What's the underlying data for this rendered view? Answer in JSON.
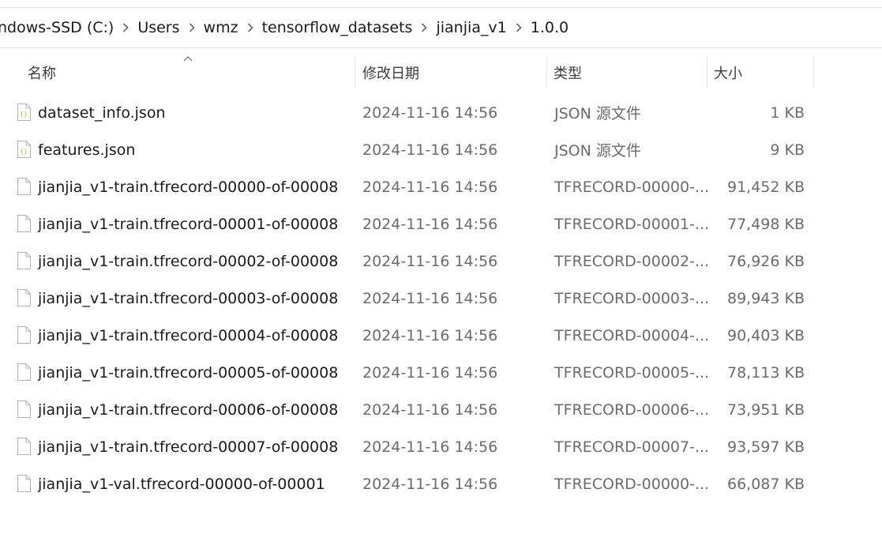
{
  "breadcrumb": {
    "items": [
      "ndows-SSD (C:)",
      "Users",
      "wmz",
      "tensorflow_datasets",
      "jianjia_v1",
      "1.0.0"
    ]
  },
  "columns": {
    "name": "名称",
    "date": "修改日期",
    "type": "类型",
    "size": "大小"
  },
  "files": [
    {
      "name": "dataset_info.json",
      "date": "2024-11-16 14:56",
      "type": "JSON 源文件",
      "size": "1 KB",
      "icon": "json-file-icon"
    },
    {
      "name": "features.json",
      "date": "2024-11-16 14:56",
      "type": "JSON 源文件",
      "size": "9 KB",
      "icon": "json-file-icon"
    },
    {
      "name": "jianjia_v1-train.tfrecord-00000-of-00008",
      "date": "2024-11-16 14:56",
      "type": "TFRECORD-00000-...",
      "size": "91,452 KB",
      "icon": "blank-file-icon"
    },
    {
      "name": "jianjia_v1-train.tfrecord-00001-of-00008",
      "date": "2024-11-16 14:56",
      "type": "TFRECORD-00001-...",
      "size": "77,498 KB",
      "icon": "blank-file-icon"
    },
    {
      "name": "jianjia_v1-train.tfrecord-00002-of-00008",
      "date": "2024-11-16 14:56",
      "type": "TFRECORD-00002-...",
      "size": "76,926 KB",
      "icon": "blank-file-icon"
    },
    {
      "name": "jianjia_v1-train.tfrecord-00003-of-00008",
      "date": "2024-11-16 14:56",
      "type": "TFRECORD-00003-...",
      "size": "89,943 KB",
      "icon": "blank-file-icon"
    },
    {
      "name": "jianjia_v1-train.tfrecord-00004-of-00008",
      "date": "2024-11-16 14:56",
      "type": "TFRECORD-00004-...",
      "size": "90,403 KB",
      "icon": "blank-file-icon"
    },
    {
      "name": "jianjia_v1-train.tfrecord-00005-of-00008",
      "date": "2024-11-16 14:56",
      "type": "TFRECORD-00005-...",
      "size": "78,113 KB",
      "icon": "blank-file-icon"
    },
    {
      "name": "jianjia_v1-train.tfrecord-00006-of-00008",
      "date": "2024-11-16 14:56",
      "type": "TFRECORD-00006-...",
      "size": "73,951 KB",
      "icon": "blank-file-icon"
    },
    {
      "name": "jianjia_v1-train.tfrecord-00007-of-00008",
      "date": "2024-11-16 14:56",
      "type": "TFRECORD-00007-...",
      "size": "93,597 KB",
      "icon": "blank-file-icon"
    },
    {
      "name": "jianjia_v1-val.tfrecord-00000-of-00001",
      "date": "2024-11-16 14:56",
      "type": "TFRECORD-00000-...",
      "size": "66,087 KB",
      "icon": "blank-file-icon"
    }
  ],
  "colors": {
    "text": "#1a1a1a",
    "muted": "#6b6b6b",
    "divider": "#e5e5e5",
    "json_icon": "#b8c13a"
  }
}
